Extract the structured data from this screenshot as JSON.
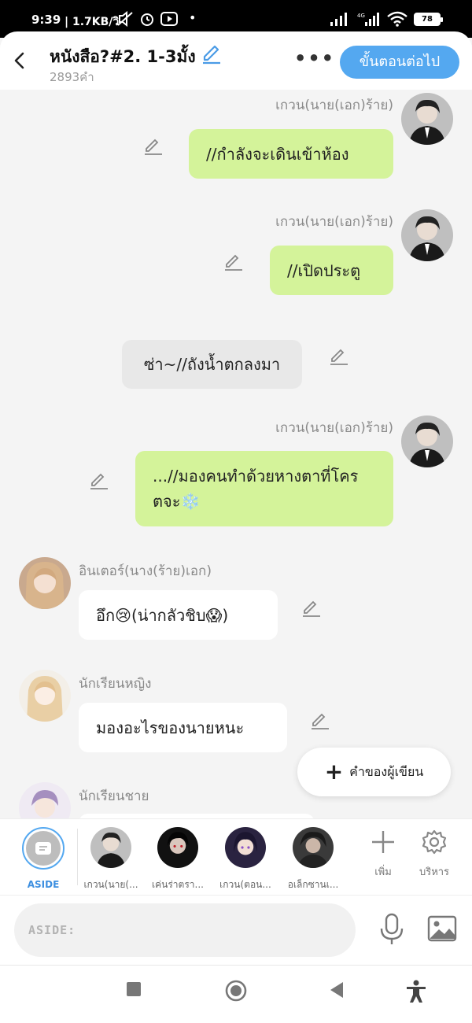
{
  "status_bar": {
    "time": "9:39",
    "network_speed": "| 1.7KB/วิ",
    "battery": "78"
  },
  "header": {
    "title": "หนังสือ?#2. 1-3มั้ง",
    "word_count": "2893คำ",
    "more": "•••",
    "next_button": "ขั้นตอนต่อไป"
  },
  "messages": [
    {
      "speaker": "เกวน(นาย(เอก)ร้าย)",
      "text": "//กำลังจะเดินเข้าห้อง"
    },
    {
      "speaker": "เกวน(นาย(เอก)ร้าย)",
      "text": "//เปิดประตู"
    },
    {
      "speaker": "",
      "text": "ซ่า~//ถังน้ำตกลงมา"
    },
    {
      "speaker": "เกวน(นาย(เอก)ร้าย)",
      "text": "...//มองคนทำด้วยหางตาที่โครตจะ❄️"
    },
    {
      "speaker": "อินเตอร์(นาง(ร้าย)เอก)",
      "text": "อึก😢(น่ากลัวชิบ😱)"
    },
    {
      "speaker": "นักเรียนหญิง",
      "text": "มองอะไรของนายหนะ"
    },
    {
      "speaker": "นักเรียนชาย",
      "text": ""
    }
  ],
  "author_button": {
    "icon": "+",
    "label": "คำของผู้เขียน"
  },
  "character_bar": {
    "aside_label": "ASIDE",
    "characters": [
      "เกวน(นาย(...",
      "เค่นร่าตรา...",
      "เกวน(ตอน...",
      "อเล็กซานเ..."
    ],
    "add_label": "เพิ่ม",
    "manage_label": "บริหาร"
  },
  "input": {
    "placeholder": "ASIDE:"
  },
  "colors": {
    "accent": "#54a8f0",
    "green_bubble": "#d4f39a"
  }
}
